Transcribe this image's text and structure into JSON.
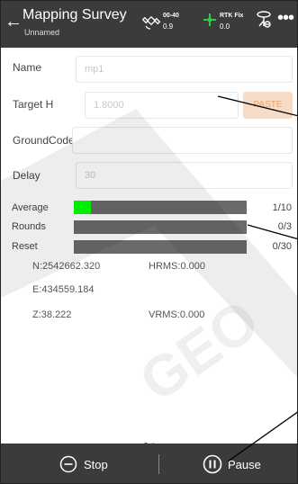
{
  "header": {
    "title": "Mapping Survey",
    "subtitle": "Unnamed",
    "sat_top": "00-40",
    "sat_bottom": "0.9",
    "rtk_top": "RTK Fix",
    "rtk_bottom": "0.0"
  },
  "form": {
    "name_label": "Name",
    "name_placeholder": "mp1",
    "target_label": "Target H",
    "target_placeholder": "1.8000",
    "paste_label": "PASTE",
    "groundcode_label": "GroundCode",
    "groundcode_value": "",
    "delay_label": "Delay",
    "delay_placeholder": "30"
  },
  "progress": [
    {
      "label": "Average",
      "count": "1/10",
      "fill": 0.1
    },
    {
      "label": "Rounds",
      "count": "0/3",
      "fill": 0
    },
    {
      "label": "Reset",
      "count": "0/30",
      "fill": 0
    }
  ],
  "coords": {
    "n": "N:2542662.320",
    "e": "E:434559.184",
    "z": "Z:38.222",
    "hrms": "HRMS:0.000",
    "vrms": "VRMS:0.000"
  },
  "footer": {
    "stop_label": "Stop",
    "pause_label": "Pause"
  },
  "watermark": "GEO",
  "colors": {
    "header_bg": "#3b3b3b",
    "progress_fill": "#00ff00",
    "progress_track": "#6a6a6a",
    "paste_bg": "#f6dcc6",
    "paste_text": "#f2a36b",
    "rtk_green": "#2ecc40"
  }
}
